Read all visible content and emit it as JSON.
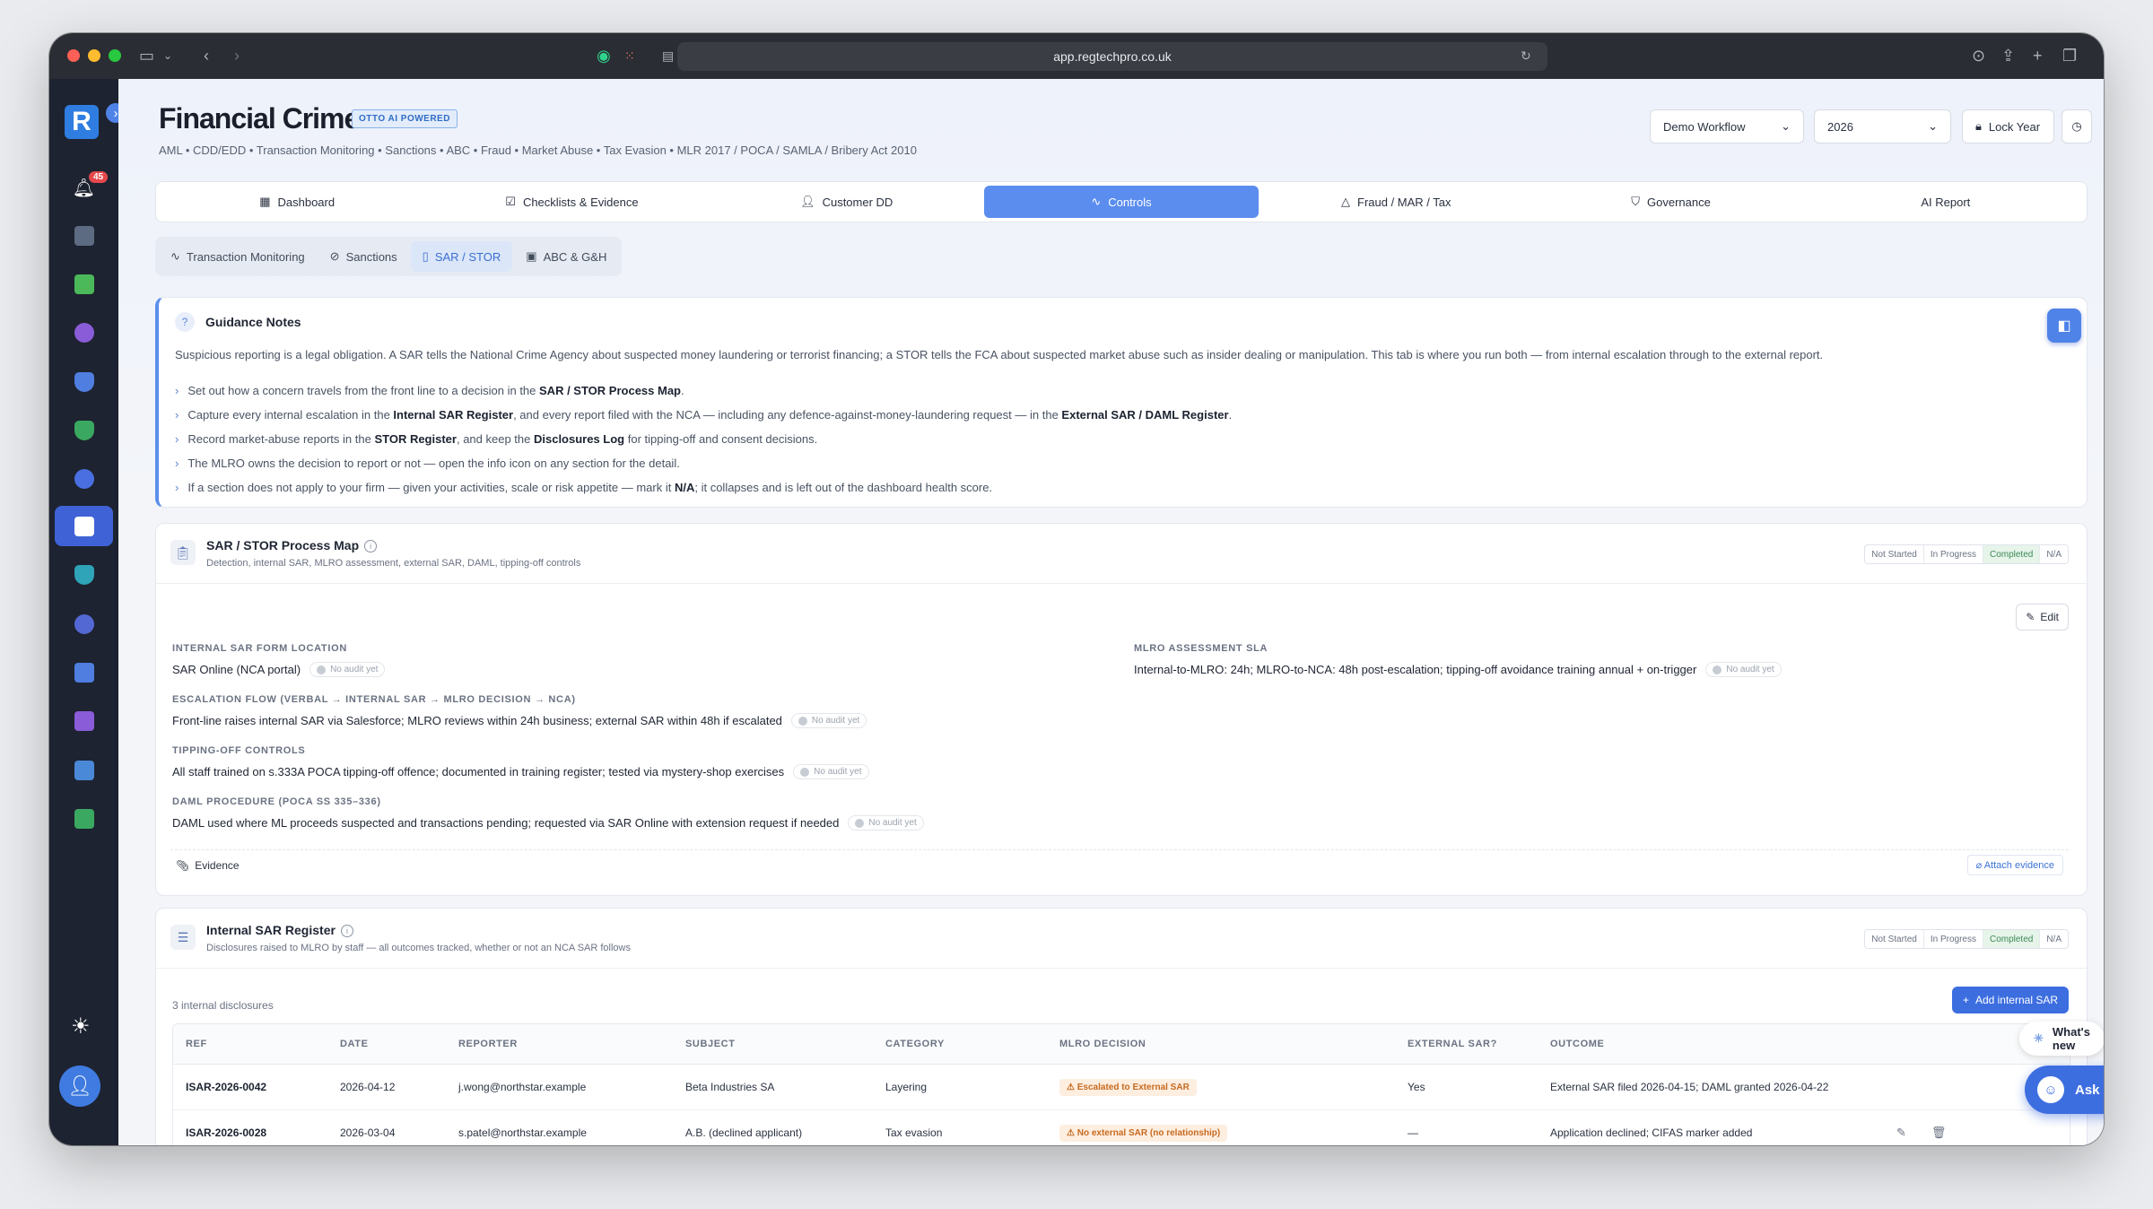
{
  "browser": {
    "url": "app.regtechpro.co.uk"
  },
  "sidebar": {
    "notifications_count": "45"
  },
  "header": {
    "title": "Financial Crime",
    "badge": "OTTO AI POWERED",
    "subtitle": "AML • CDD/EDD • Transaction Monitoring • Sanctions • ABC • Fraud • Market Abuse • Tax Evasion • MLR 2017 / POCA / SAMLA / Bribery Act 2010",
    "workflow": "Demo Workflow",
    "year": "2026",
    "lock": "Lock Year"
  },
  "main_tabs": [
    "Dashboard",
    "Checklists & Evidence",
    "Customer DD",
    "Controls",
    "Fraud / MAR / Tax",
    "Governance",
    "AI Report"
  ],
  "sub_tabs": [
    "Transaction Monitoring",
    "Sanctions",
    "SAR / STOR",
    "ABC & G&H"
  ],
  "guidance": {
    "title": "Guidance Notes",
    "intro": "Suspicious reporting is a legal obligation. A SAR tells the National Crime Agency about suspected money laundering or terrorist financing; a STOR tells the FCA about suspected market abuse such as insider dealing or manipulation. This tab is where you run both — from internal escalation through to the external report.",
    "items": [
      {
        "a": "Set out how a concern travels from the front line to a decision in the ",
        "b": "SAR / STOR Process Map",
        "c": "."
      },
      {
        "a": "Capture every internal escalation in the ",
        "b": "Internal SAR Register",
        "c": ", and every report filed with the NCA — including any defence-against-money-laundering request — in the ",
        "d": "External SAR / DAML Register",
        "e": "."
      },
      {
        "a": "Record market-abuse reports in the ",
        "b": "STOR Register",
        "c": ", and keep the ",
        "d": "Disclosures Log",
        "e": " for tipping-off and consent decisions."
      },
      {
        "a": "The MLRO owns the decision to report or not — open the info icon on any section for the detail.",
        "b": "",
        "c": ""
      },
      {
        "a": "If a section does not apply to your firm — given your activities, scale or risk appetite — mark it ",
        "b": "N/A",
        "c": "; it collapses and is left out of the dashboard health score."
      }
    ]
  },
  "status_options": [
    "Not Started",
    "In Progress",
    "Completed",
    "N/A"
  ],
  "process_map": {
    "title": "SAR / STOR Process Map",
    "subtitle": "Detection, internal SAR, MLRO assessment, external SAR, DAML, tipping-off controls",
    "edit": "Edit",
    "no_audit": "No audit yet",
    "fields": [
      {
        "label": "Internal SAR form location",
        "value": "SAR Online (NCA portal)"
      },
      {
        "label": "MLRO assessment SLA",
        "value": "Internal-to-MLRO: 24h; MLRO-to-NCA: 48h post-escalation; tipping-off avoidance training annual + on-trigger"
      },
      {
        "label": "Escalation flow (verbal → internal SAR → MLRO decision → NCA)",
        "value": "Front-line raises internal SAR via Salesforce; MLRO reviews within 24h business; external SAR within 48h if escalated"
      },
      {
        "label": "Tipping-off controls",
        "value": "All staff trained on s.333A POCA tipping-off offence; documented in training register; tested via mystery-shop exercises"
      },
      {
        "label": "DAML procedure (POCA ss 335–336)",
        "value": "DAML used where ML proceeds suspected and transactions pending; requested via SAR Online with extension request if needed"
      }
    ],
    "evidence": "Evidence",
    "attach": "Attach evidence"
  },
  "internal_register": {
    "title": "Internal SAR Register",
    "subtitle": "Disclosures raised to MLRO by staff — all outcomes tracked, whether or not an NCA SAR follows",
    "count": "3 internal disclosures",
    "add": "Add internal SAR",
    "columns": [
      "Ref",
      "Date",
      "Reporter",
      "Subject",
      "Category",
      "MLRO Decision",
      "External SAR?",
      "Outcome"
    ],
    "rows": [
      {
        "ref": "ISAR-2026-0042",
        "date": "2026-04-12",
        "reporter": "j.wong@northstar.example",
        "subject": "Beta Industries SA",
        "category": "Layering",
        "decision": "Escalated to External SAR",
        "external": "Yes",
        "outcome": "External SAR filed 2026-04-15; DAML granted 2026-04-22"
      },
      {
        "ref": "ISAR-2026-0028",
        "date": "2026-03-04",
        "reporter": "s.patel@northstar.example",
        "subject": "A.B. (declined applicant)",
        "category": "Tax evasion",
        "decision": "No external SAR (no relationship)",
        "external": "—",
        "outcome": "Application declined; CIFAS marker added"
      }
    ]
  },
  "floating": {
    "whats_new": "What's new",
    "ask_otto": "Ask Otto"
  }
}
